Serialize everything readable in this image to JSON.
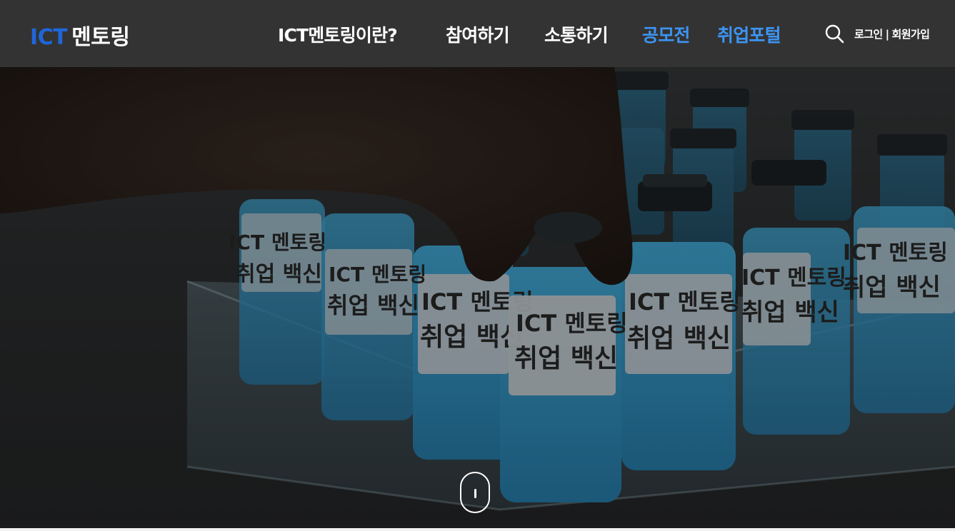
{
  "header": {
    "logo": {
      "ict": "ICT",
      "rest": "멘토링"
    },
    "nav": [
      {
        "label": "ICT멘토링이란?"
      },
      {
        "label": "참여하기"
      },
      {
        "label": "소통하기"
      },
      {
        "label": "공모전"
      },
      {
        "label": "취업포털"
      }
    ],
    "search_icon": "search-icon",
    "login": "로그인",
    "separator": "|",
    "signup": "회원가입"
  },
  "hero": {
    "vial_label_line1": "ICT 멘토링",
    "vial_label_line2": "취업 백신"
  },
  "colors": {
    "header_bg": "#333333",
    "logo_accent": "#1f66d9",
    "nav_highlight": "#3d94f2",
    "vial_liquid": "#3aa6d8"
  }
}
